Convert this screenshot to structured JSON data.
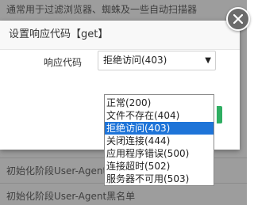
{
  "background": {
    "top_text": "通常用于过滤浏览器、蜘蛛及一些自动扫描器",
    "row1_text": "初始化阶段User-Agent",
    "row2_text": "初始化阶段User-Agent黑名单"
  },
  "dialog": {
    "title": "设置响应代码【get】",
    "field_label": "响应代码",
    "select_value": "拒绝访问(403)",
    "close_icon": "close-icon"
  },
  "dropdown": {
    "options": [
      "正常(200)",
      "文件不存在(404)",
      "拒绝访问(403)",
      "关闭连接(444)",
      "应用程序错误(500)",
      "连接超时(502)",
      "服务器不可用(503)"
    ],
    "selected_index": 2
  },
  "colors": {
    "selected_bg": "#1e74d8",
    "confirm_button": "#2fae62",
    "overlay": "#9d9d9d"
  }
}
